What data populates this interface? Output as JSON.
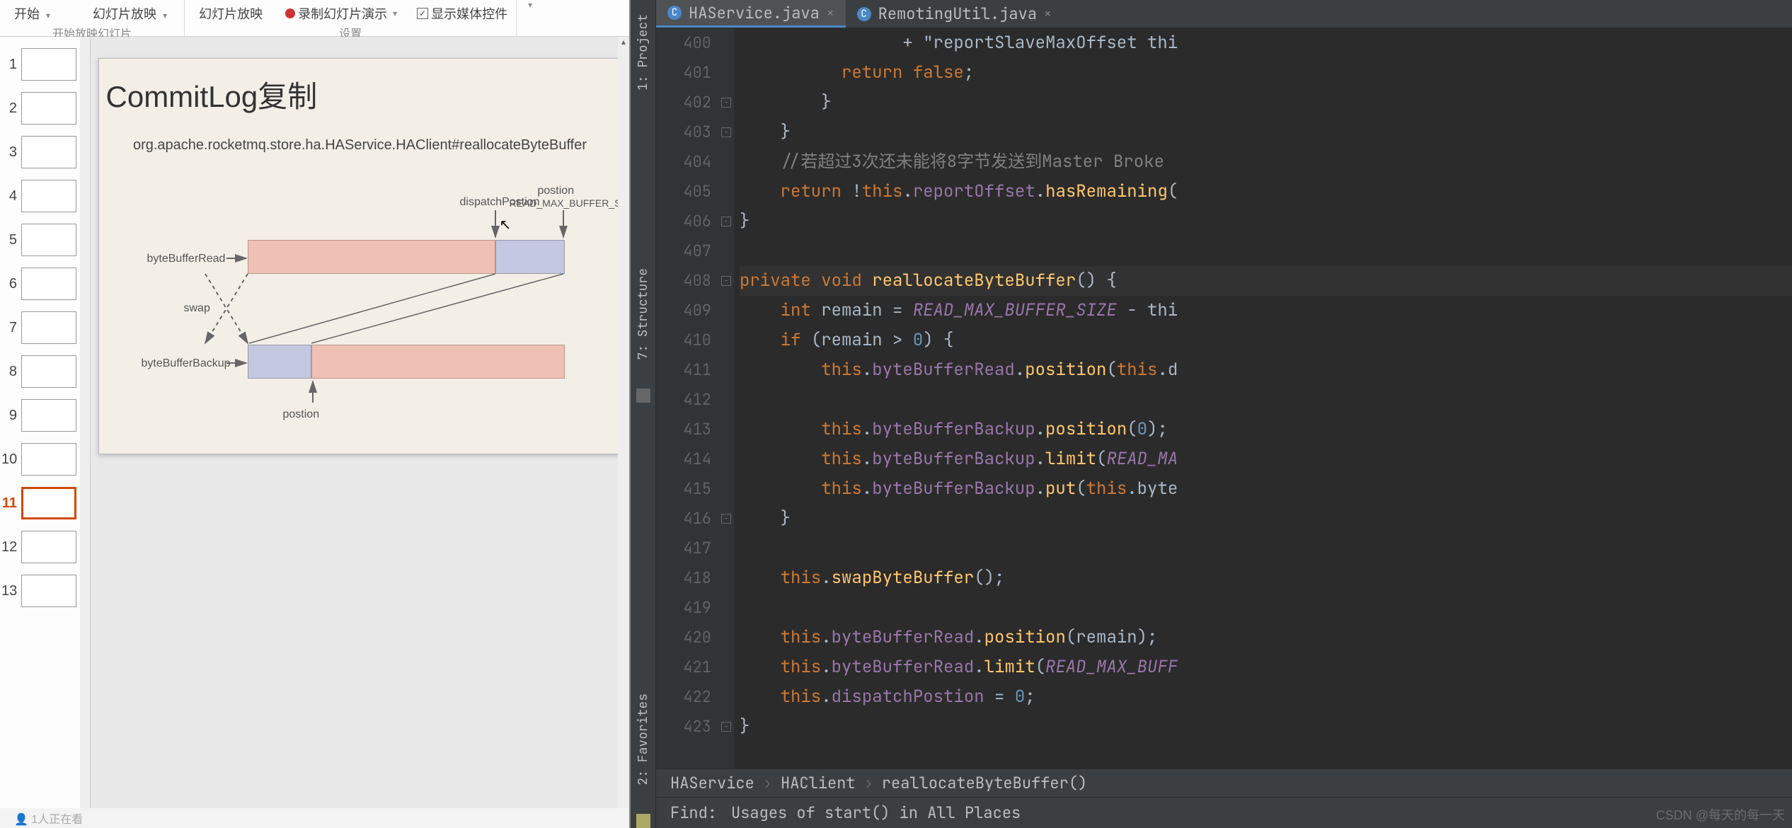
{
  "ppt": {
    "ribbon": {
      "start": "开始",
      "slideshow1": "幻灯片放映",
      "slideshow2": "幻灯片放映",
      "record": "录制幻灯片演示",
      "show_media": "显示媒体控件",
      "group1_label": "开始放映幻灯片",
      "group2_label": "设置"
    },
    "thumbs": [
      {
        "n": "1"
      },
      {
        "n": "2"
      },
      {
        "n": "3"
      },
      {
        "n": "4"
      },
      {
        "n": "5"
      },
      {
        "n": "6"
      },
      {
        "n": "7"
      },
      {
        "n": "8"
      },
      {
        "n": "9"
      },
      {
        "n": "10"
      },
      {
        "n": "11",
        "active": true
      },
      {
        "n": "12"
      },
      {
        "n": "13"
      }
    ],
    "slide": {
      "title": "CommitLog复制",
      "sub": "org.apache.rocketmq.store.ha.HAService.HAClient#reallocateByteBuffer",
      "label_dispatch": "dispatchPostion",
      "label_postion_top": "postion",
      "label_readmax": "READ_MAX_BUFFER_SIZE",
      "label_bbread": "byteBufferRead",
      "label_swap": "swap",
      "label_bbbackup": "byteBufferBackup",
      "label_postion_bot": "postion"
    },
    "status": "1人正在看"
  },
  "ide": {
    "sidebar": {
      "project": "1: Project",
      "structure": "7: Structure",
      "favorites": "2: Favorites"
    },
    "tabs": [
      {
        "label": "HAService.java",
        "active": true
      },
      {
        "label": "RemotingUtil.java",
        "active": false
      }
    ],
    "line_start": 400,
    "breadcrumb": [
      "HAService",
      "HAClient",
      "reallocateByteBuffer()"
    ],
    "find": {
      "label": "Find:",
      "text": "Usages of start() in All Places"
    },
    "code_lines": [
      "                + \"reportSlaveMaxOffset thi",
      "          return false;",
      "        }",
      "    }",
      "    //若超过3次还未能将8字节发送到Master Broke",
      "    return !this.reportOffset.hasRemaining(",
      "}",
      "",
      "private void reallocateByteBuffer() {",
      "    int remain = READ_MAX_BUFFER_SIZE - thi",
      "    if (remain > 0) {",
      "        this.byteBufferRead.position(this.d",
      "",
      "        this.byteBufferBackup.position(0);",
      "        this.byteBufferBackup.limit(READ_MA",
      "        this.byteBufferBackup.put(this.byte",
      "    }",
      "",
      "    this.swapByteBuffer();",
      "",
      "    this.byteBufferRead.position(remain);",
      "    this.byteBufferRead.limit(READ_MAX_BUFF",
      "    this.dispatchPostion = 0;",
      "}"
    ]
  },
  "watermark": "CSDN @每天的每一天"
}
